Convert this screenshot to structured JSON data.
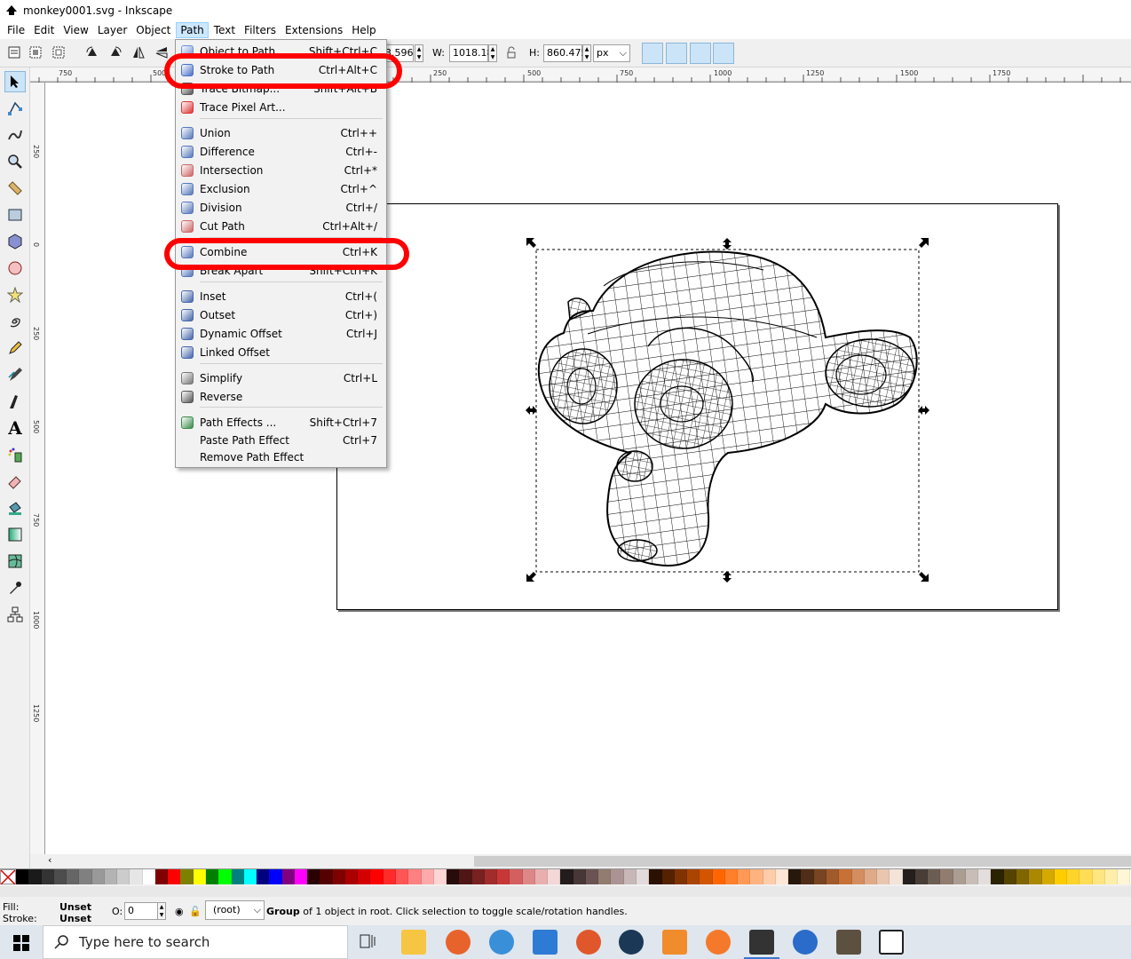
{
  "window": {
    "title": "monkey0001.svg - Inkscape"
  },
  "menubar": [
    "File",
    "Edit",
    "View",
    "Layer",
    "Object",
    "Path",
    "Text",
    "Filters",
    "Extensions",
    "Help"
  ],
  "toolbar": {
    "y_partial": "3.596",
    "w_label": "W:",
    "w_value": "1018.18",
    "h_label": "H:",
    "h_value": "860.475",
    "unit": "px"
  },
  "rulers": {
    "h_ticks": [
      "750",
      "500",
      "250",
      "250",
      "500",
      "750",
      "1000",
      "1250",
      "1500",
      "1750"
    ],
    "v_ticks": [
      "250",
      "0",
      "250",
      "500",
      "750",
      "1000",
      "1250"
    ]
  },
  "path_menu": {
    "items": [
      {
        "label": "Object to Path",
        "shortcut": "Shift+Ctrl+C",
        "icon": "object-to-path-icon"
      },
      {
        "label": "Stroke to Path",
        "shortcut": "Ctrl+Alt+C",
        "icon": "stroke-to-path-icon"
      },
      {
        "label": "Trace Bitmap...",
        "shortcut": "Shift+Alt+B",
        "icon": "trace-bitmap-icon"
      },
      {
        "label": "Trace Pixel Art...",
        "shortcut": "",
        "icon": "trace-pixel-art-icon"
      },
      {
        "label": "Union",
        "shortcut": "Ctrl++",
        "icon": "union-icon"
      },
      {
        "label": "Difference",
        "shortcut": "Ctrl+-",
        "icon": "difference-icon"
      },
      {
        "label": "Intersection",
        "shortcut": "Ctrl+*",
        "icon": "intersection-icon"
      },
      {
        "label": "Exclusion",
        "shortcut": "Ctrl+^",
        "icon": "exclusion-icon"
      },
      {
        "label": "Division",
        "shortcut": "Ctrl+/",
        "icon": "division-icon"
      },
      {
        "label": "Cut Path",
        "shortcut": "Ctrl+Alt+/",
        "icon": "cut-path-icon"
      },
      {
        "label": "Combine",
        "shortcut": "Ctrl+K",
        "icon": "combine-icon"
      },
      {
        "label": "Break Apart",
        "shortcut": "Shift+Ctrl+K",
        "icon": "break-apart-icon"
      },
      {
        "label": "Inset",
        "shortcut": "Ctrl+(",
        "icon": "inset-icon"
      },
      {
        "label": "Outset",
        "shortcut": "Ctrl+)",
        "icon": "outset-icon"
      },
      {
        "label": "Dynamic Offset",
        "shortcut": "Ctrl+J",
        "icon": "dynamic-offset-icon"
      },
      {
        "label": "Linked Offset",
        "shortcut": "",
        "icon": "linked-offset-icon"
      },
      {
        "label": "Simplify",
        "shortcut": "Ctrl+L",
        "icon": "simplify-icon"
      },
      {
        "label": "Reverse",
        "shortcut": "",
        "icon": "reverse-icon"
      },
      {
        "label": "Path Effects ...",
        "shortcut": "Shift+Ctrl+7",
        "icon": "path-effects-icon"
      },
      {
        "label": "Paste Path Effect",
        "shortcut": "Ctrl+7",
        "icon": ""
      },
      {
        "label": "Remove Path Effect",
        "shortcut": "",
        "icon": ""
      }
    ]
  },
  "status": {
    "fill_label": "Fill:",
    "fill_value": "Unset",
    "stroke_label": "Stroke:",
    "stroke_value": "Unset",
    "opacity_label": "O:",
    "opacity_value": "0",
    "layer": "(root)",
    "message_bold": "Group",
    "message": " of 1 object in root. Click selection to toggle scale/rotation handles."
  },
  "taskbar": {
    "search_placeholder": "Type here to search"
  },
  "colors": {
    "accent": "#cce8ff",
    "annotation_red": "#ff0000"
  }
}
